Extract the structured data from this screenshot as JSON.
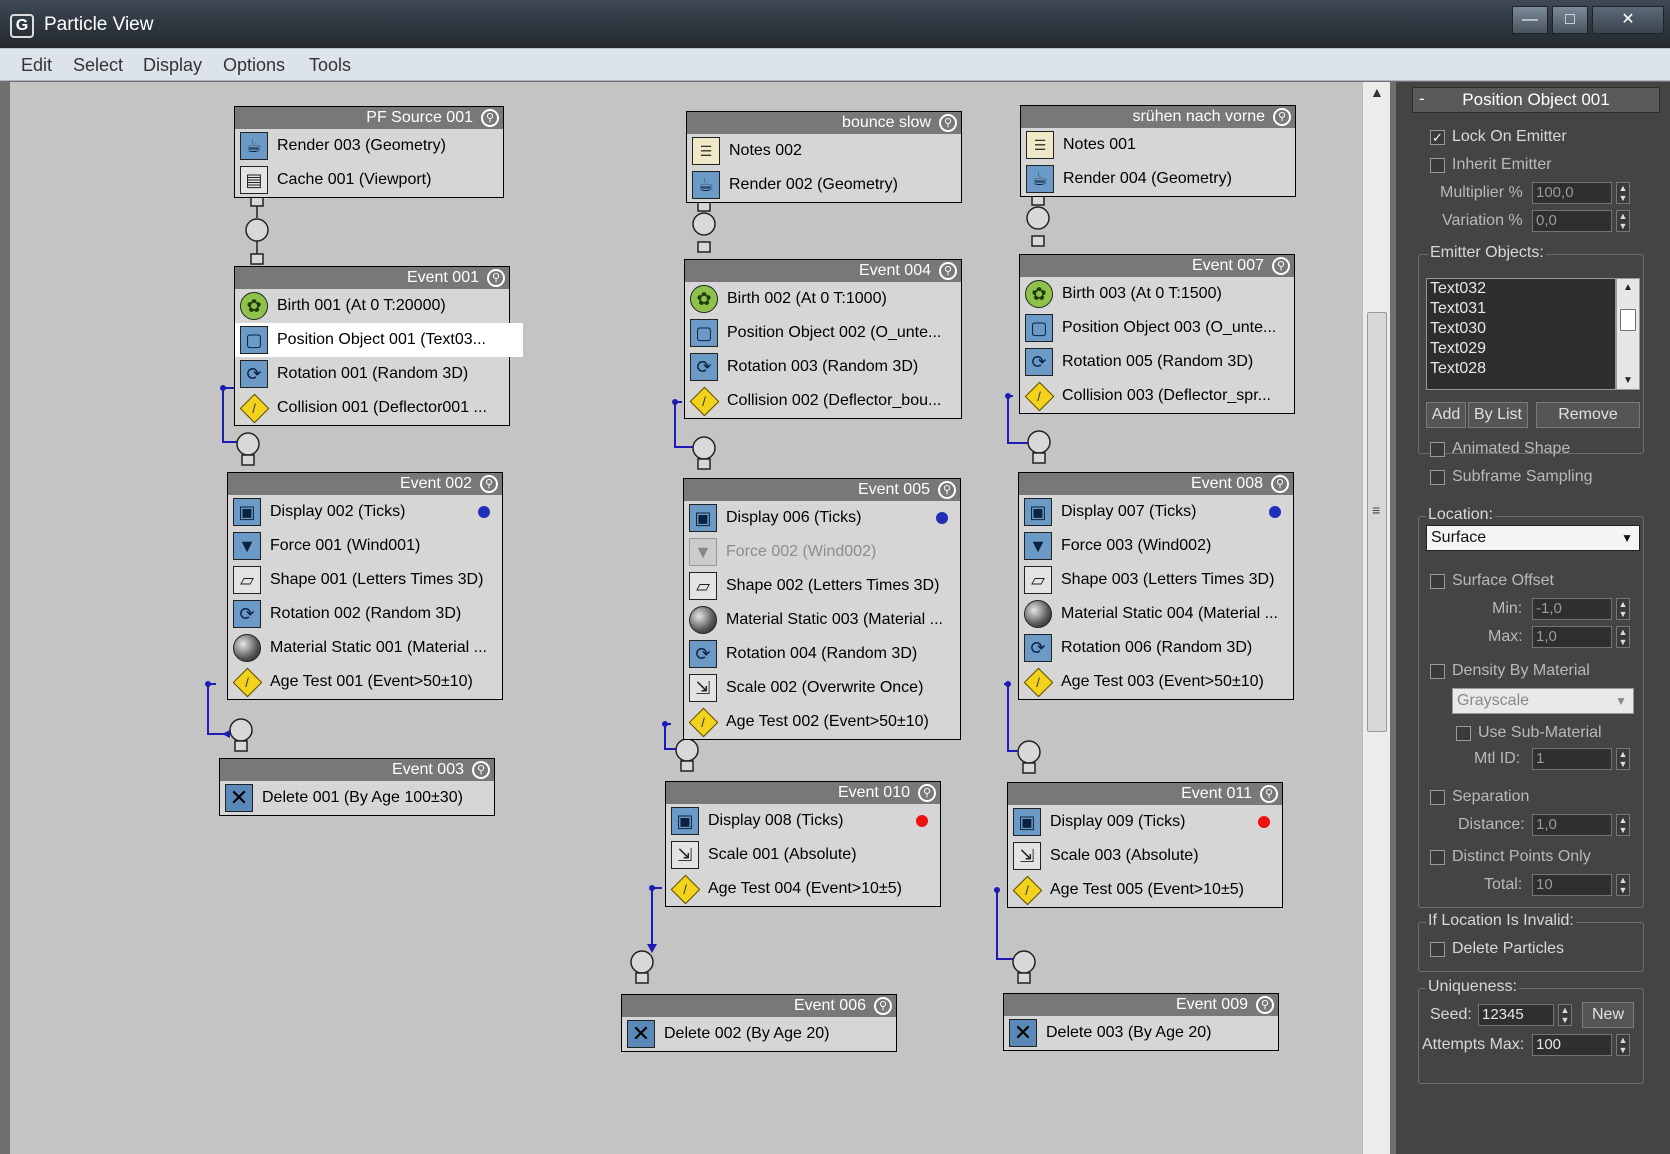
{
  "window": {
    "title": "Particle View",
    "app_icon": "G"
  },
  "menu": [
    "Edit",
    "Select",
    "Display",
    "Options",
    "Tools"
  ],
  "colors": {
    "blue_dot": "#1f2fb8",
    "red_dot": "#ee1111",
    "wire": "#1c1cb5",
    "canvas": "#c4c4c4",
    "panel": "#444444"
  },
  "nodes": {
    "pfsource": {
      "title": "PF Source 001",
      "ops": [
        "Render 003 (Geometry)",
        "Cache 001 (Viewport)"
      ]
    },
    "bounce": {
      "title": "bounce slow",
      "ops": [
        "Notes 002",
        "Render 002 (Geometry)"
      ]
    },
    "spruehen": {
      "title": "srühen nach vorne",
      "ops": [
        "Notes 001",
        "Render 004 (Geometry)"
      ]
    },
    "e001": {
      "title": "Event 001",
      "ops": [
        "Birth 001 (At 0 T:20000)",
        "Position Object 001 (Text03...",
        "Rotation 001 (Random 3D)",
        "Collision 001 (Deflector001 ..."
      ]
    },
    "e004": {
      "title": "Event 004",
      "ops": [
        "Birth 002 (At 0 T:1000)",
        "Position Object 002 (O_unte...",
        "Rotation 003 (Random 3D)",
        "Collision 002 (Deflector_bou..."
      ]
    },
    "e007": {
      "title": "Event 007",
      "ops": [
        "Birth 003 (At 0 T:1500)",
        "Position Object 003 (O_unte...",
        "Rotation 005 (Random 3D)",
        "Collision 003 (Deflector_spr..."
      ]
    },
    "e002": {
      "title": "Event 002",
      "ops": [
        "Display 002 (Ticks)",
        "Force 001 (Wind001)",
        "Shape 001 (Letters Times 3D)",
        "Rotation 002 (Random 3D)",
        "Material Static 001 (Material ...",
        "Age Test 001 (Event>50±10)"
      ]
    },
    "e005": {
      "title": "Event 005",
      "ops": [
        "Display 006 (Ticks)",
        "Force 002 (Wind002)",
        "Shape 002 (Letters Times 3D)",
        "Material Static 003 (Material ...",
        "Rotation 004 (Random 3D)",
        "Scale 002 (Overwrite Once)",
        "Age Test 002 (Event>50±10)"
      ]
    },
    "e008": {
      "title": "Event 008",
      "ops": [
        "Display 007 (Ticks)",
        "Force 003 (Wind002)",
        "Shape 003 (Letters Times 3D)",
        "Material Static 004 (Material ...",
        "Rotation 006 (Random 3D)",
        "Age Test 003 (Event>50±10)"
      ]
    },
    "e003": {
      "title": "Event 003",
      "ops": [
        "Delete 001 (By Age 100±30)"
      ]
    },
    "e010": {
      "title": "Event 010",
      "ops": [
        "Display 008 (Ticks)",
        "Scale 001 (Absolute)",
        "Age Test 004 (Event>10±5)"
      ]
    },
    "e011": {
      "title": "Event 011",
      "ops": [
        "Display 009 (Ticks)",
        "Scale 003 (Absolute)",
        "Age Test 005 (Event>10±5)"
      ]
    },
    "e006": {
      "title": "Event 006",
      "ops": [
        "Delete 002 (By Age 20)"
      ]
    },
    "e009": {
      "title": "Event 009",
      "ops": [
        "Delete 003 (By Age 20)"
      ]
    }
  },
  "panel": {
    "rollout_title": "Position Object 001",
    "lock_on_emitter": "Lock On Emitter",
    "inherit_emitter": "Inherit Emitter",
    "multiplier_label": "Multiplier %",
    "multiplier_value": "100,0",
    "variation_label": "Variation %",
    "variation_value": "0,0",
    "emitter_objects_label": "Emitter Objects:",
    "emitter_objects": [
      "Text032",
      "Text031",
      "Text030",
      "Text029",
      "Text028"
    ],
    "add": "Add",
    "by_list": "By List",
    "remove": "Remove",
    "animated_shape": "Animated Shape",
    "subframe_sampling": "Subframe Sampling",
    "location_label": "Location:",
    "location_value": "Surface",
    "surface_offset": "Surface Offset",
    "min_label": "Min:",
    "min_value": "-1,0",
    "max_label": "Max:",
    "max_value": "1,0",
    "density_by_material": "Density By Material",
    "grayscale": "Grayscale",
    "use_sub_material": "Use Sub-Material",
    "mtl_id_label": "Mtl ID:",
    "mtl_id_value": "1",
    "separation": "Separation",
    "distance_label": "Distance:",
    "distance_value": "1,0",
    "distinct_points_only": "Distinct Points Only",
    "total_label": "Total:",
    "total_value": "10",
    "if_invalid_label": "If Location Is Invalid:",
    "delete_particles": "Delete Particles",
    "uniqueness_label": "Uniqueness:",
    "seed_label": "Seed:",
    "seed_value": "12345",
    "new": "New",
    "attempts_label": "Attempts Max:",
    "attempts_value": "100"
  }
}
